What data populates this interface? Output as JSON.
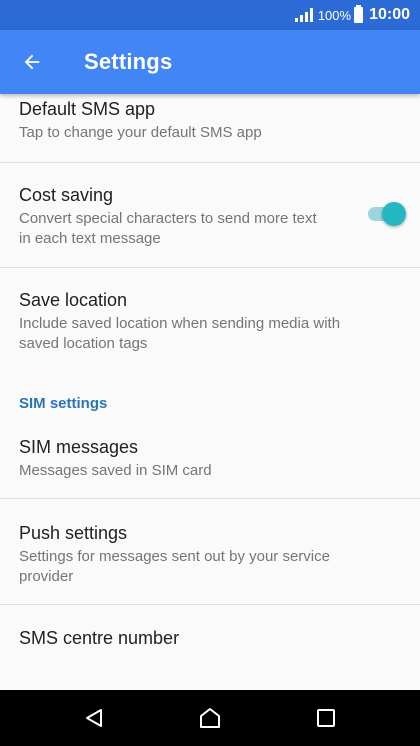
{
  "status_bar": {
    "battery": "100%",
    "time": "10:00"
  },
  "app_bar": {
    "title": "Settings",
    "back_icon": "arrow-back-icon"
  },
  "preferences": [
    {
      "title": "Default SMS app",
      "summary": "Tap to change your default SMS app"
    },
    {
      "title": "Cost saving",
      "summary": "Convert special characters to send more text in each text message",
      "toggle_on": true
    },
    {
      "title": "Save location",
      "summary": "Include saved location when sending media with saved location tags"
    },
    {
      "title": "SIM messages",
      "summary": "Messages saved in SIM card"
    },
    {
      "title": "Push settings",
      "summary": "Settings for messages sent out by your service provider"
    },
    {
      "title": "SMS centre number",
      "summary": ""
    }
  ],
  "section": {
    "sim_settings": "SIM settings"
  },
  "nav_bar": {
    "back_icon": "nav-back-icon",
    "home_icon": "nav-home-icon",
    "recents_icon": "nav-recents-icon"
  },
  "colors": {
    "app_bar": "#4285f4",
    "status_bar": "#2c6bd6",
    "accent": "#26b8c2",
    "section_header": "#2a76b8"
  }
}
